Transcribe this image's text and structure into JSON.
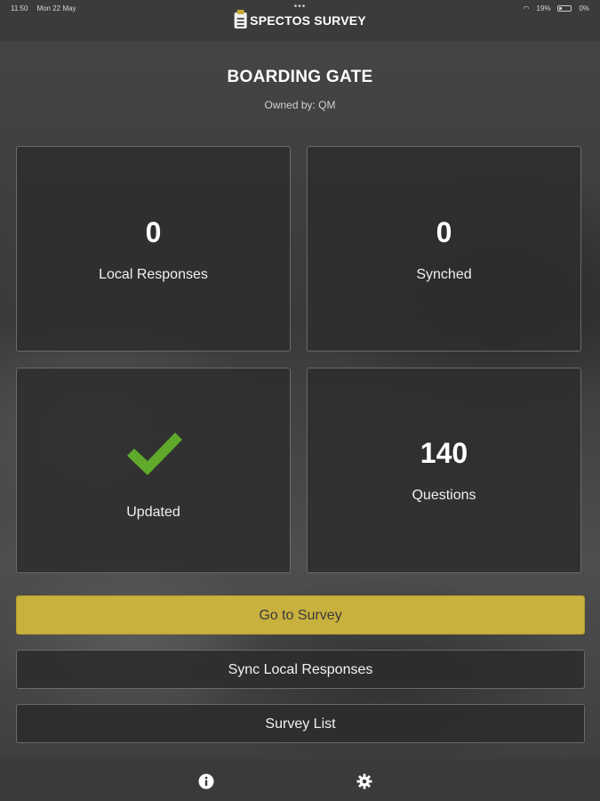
{
  "status_bar": {
    "time": "11:50",
    "date": "Mon 22 May",
    "wifi_battery": "19%",
    "battery_right": "0%"
  },
  "header": {
    "brand": "SPECTOS SURVEY",
    "icon": "clipboard-icon"
  },
  "survey": {
    "title": "BOARDING GATE",
    "owner": "Owned by: QM"
  },
  "stats": {
    "local_responses": {
      "value": "0",
      "label": "Local Responses"
    },
    "synched": {
      "value": "0",
      "label": "Synched"
    },
    "updated": {
      "label": "Updated",
      "icon": "checkmark-icon",
      "color": "#5fa92b"
    },
    "questions": {
      "value": "140",
      "label": "Questions"
    }
  },
  "actions": {
    "go_to_survey": "Go to Survey",
    "sync_local": "Sync Local Responses",
    "survey_list": "Survey List"
  },
  "bottom_nav": {
    "info_icon": "info-icon",
    "settings_icon": "gear-icon"
  },
  "colors": {
    "accent": "#c9b13e",
    "check": "#5fa92b",
    "card_bg": "#2e2e2e"
  }
}
